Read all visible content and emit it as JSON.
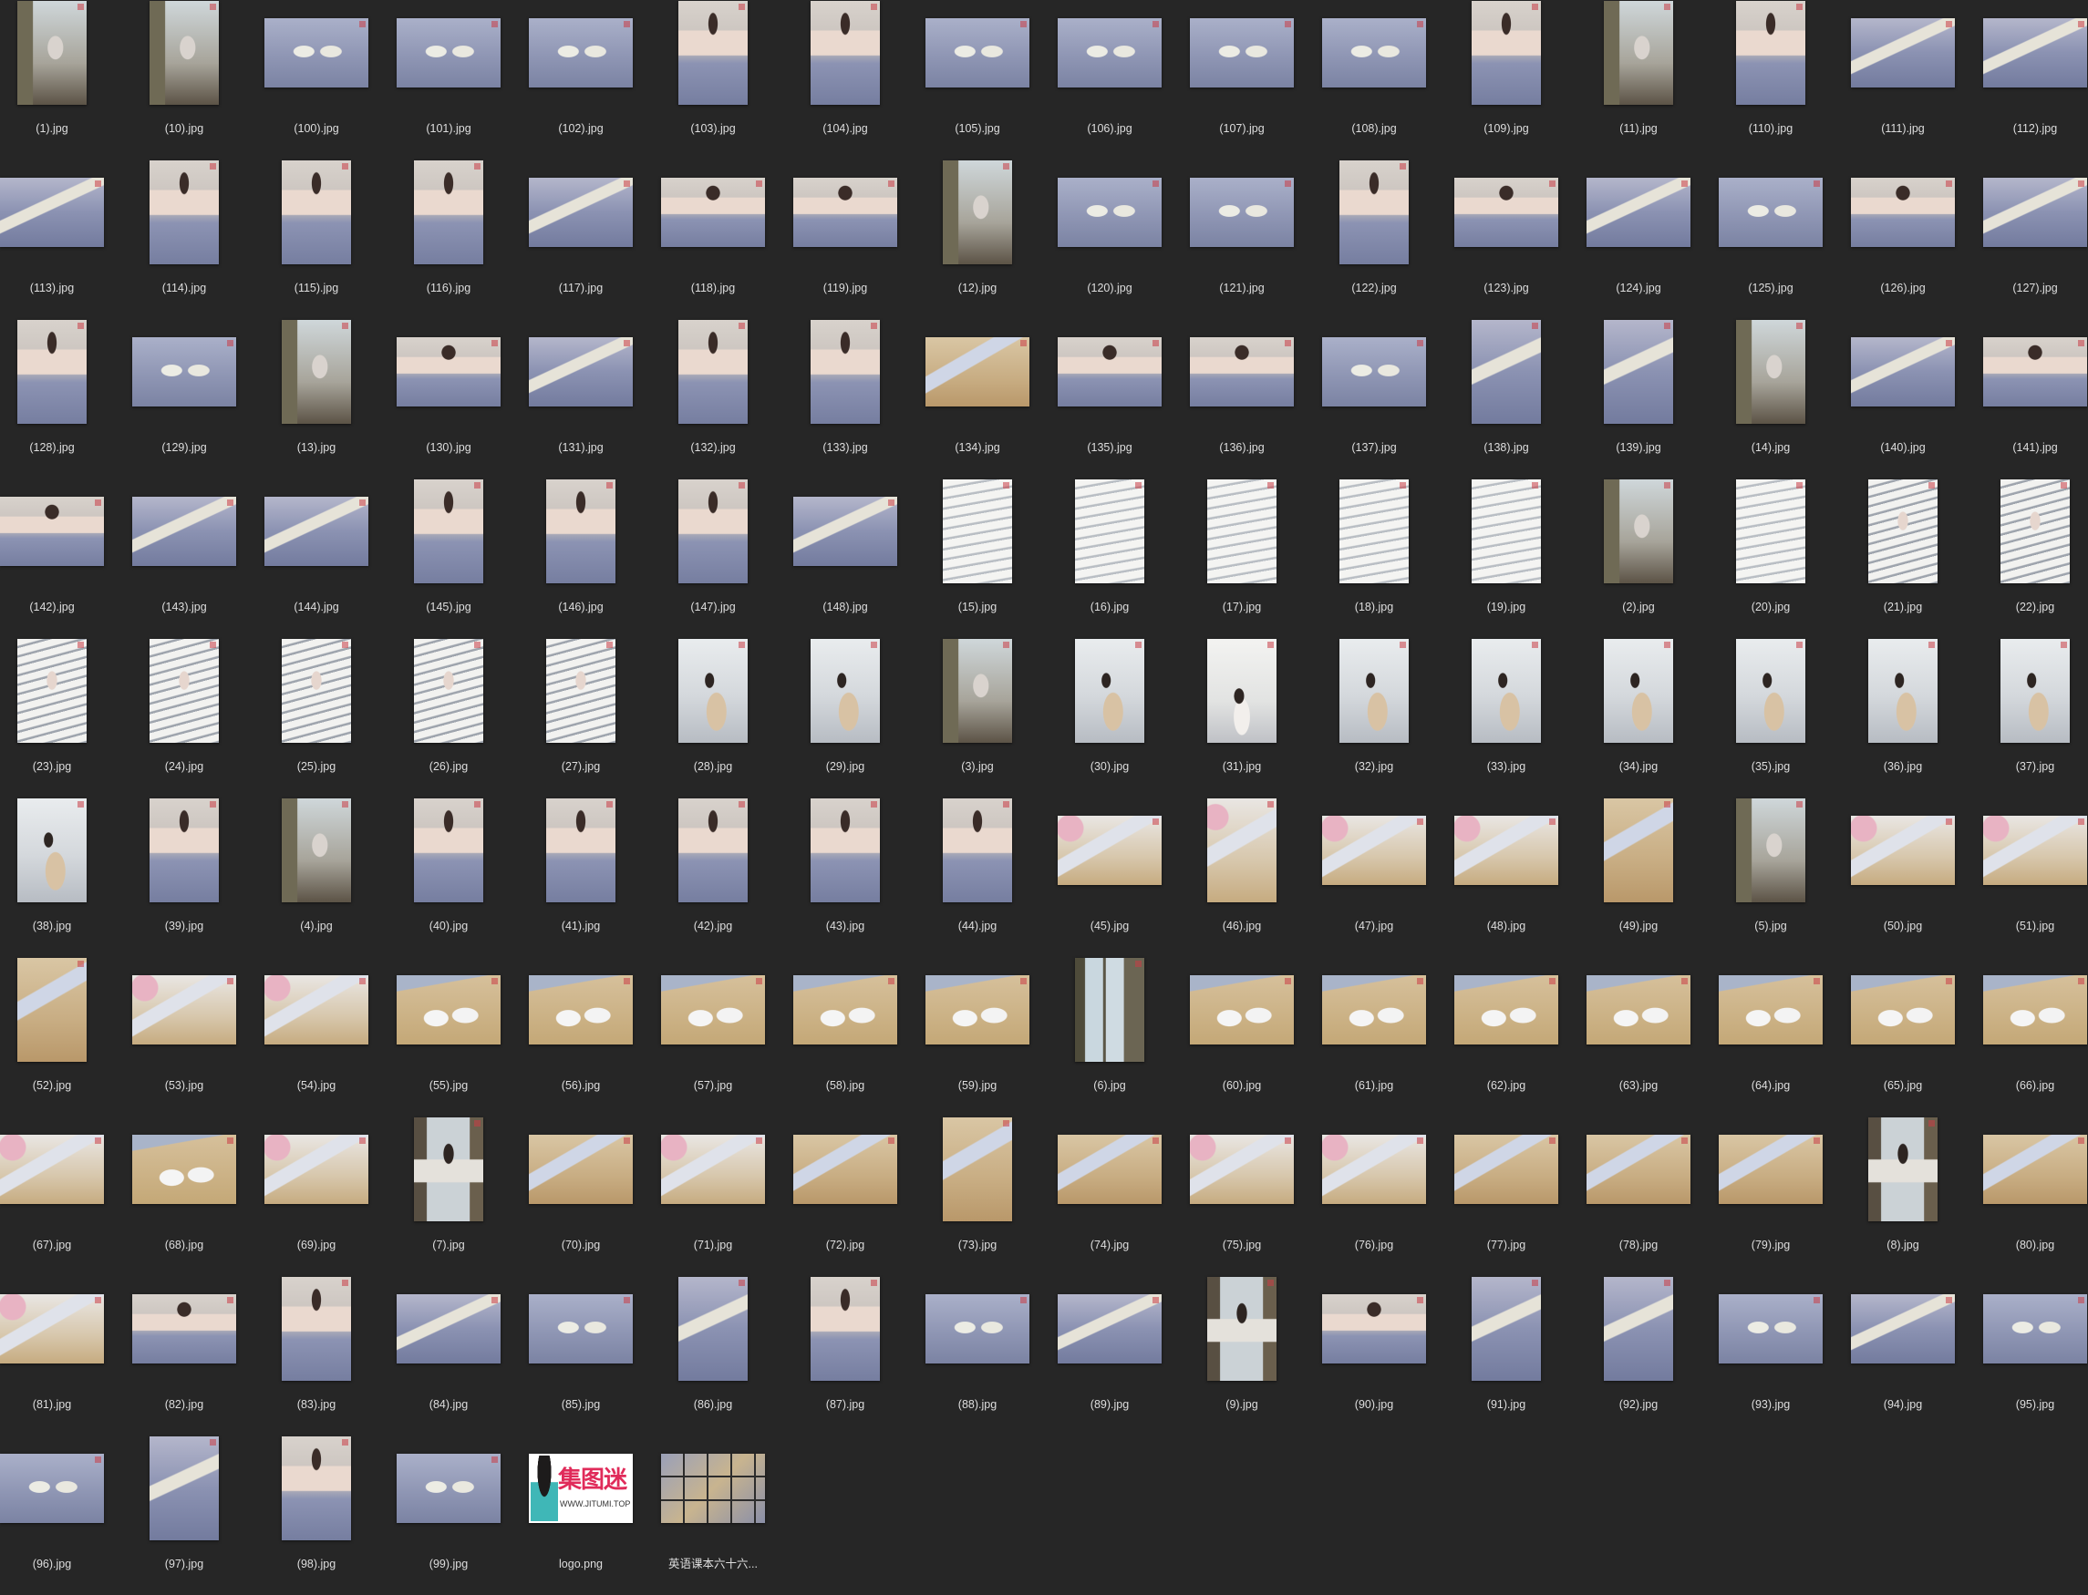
{
  "files": [
    {
      "name": "(1).jpg",
      "orient": "portrait",
      "scene": "room"
    },
    {
      "name": "(10).jpg",
      "orient": "portrait",
      "scene": "room"
    },
    {
      "name": "(100).jpg",
      "orient": "landscape",
      "scene": "bedfeet"
    },
    {
      "name": "(101).jpg",
      "orient": "landscape",
      "scene": "bedfeet"
    },
    {
      "name": "(102).jpg",
      "orient": "landscape",
      "scene": "bedfeet"
    },
    {
      "name": "(103).jpg",
      "orient": "portrait",
      "scene": "bedsit"
    },
    {
      "name": "(104).jpg",
      "orient": "portrait",
      "scene": "bedsit"
    },
    {
      "name": "(105).jpg",
      "orient": "landscape",
      "scene": "bedfeet"
    },
    {
      "name": "(106).jpg",
      "orient": "landscape",
      "scene": "bedfeet"
    },
    {
      "name": "(107).jpg",
      "orient": "landscape",
      "scene": "bedfeet"
    },
    {
      "name": "(108).jpg",
      "orient": "landscape",
      "scene": "bedfeet"
    },
    {
      "name": "(109).jpg",
      "orient": "portrait",
      "scene": "bedsit"
    },
    {
      "name": "(11).jpg",
      "orient": "portrait",
      "scene": "room"
    },
    {
      "name": "(110).jpg",
      "orient": "portrait",
      "scene": "bedsit"
    },
    {
      "name": "(111).jpg",
      "orient": "landscape",
      "scene": "bedleg"
    },
    {
      "name": "(112).jpg",
      "orient": "landscape",
      "scene": "bedleg"
    },
    {
      "name": "(113).jpg",
      "orient": "landscape",
      "scene": "bedleg"
    },
    {
      "name": "(114).jpg",
      "orient": "portrait",
      "scene": "bedsit"
    },
    {
      "name": "(115).jpg",
      "orient": "portrait",
      "scene": "bedsit"
    },
    {
      "name": "(116).jpg",
      "orient": "portrait",
      "scene": "bedsit"
    },
    {
      "name": "(117).jpg",
      "orient": "landscape",
      "scene": "bedleg"
    },
    {
      "name": "(118).jpg",
      "orient": "landscape",
      "scene": "bedsit"
    },
    {
      "name": "(119).jpg",
      "orient": "landscape",
      "scene": "bedsit"
    },
    {
      "name": "(12).jpg",
      "orient": "portrait",
      "scene": "room"
    },
    {
      "name": "(120).jpg",
      "orient": "landscape",
      "scene": "bedfeet"
    },
    {
      "name": "(121).jpg",
      "orient": "landscape",
      "scene": "bedfeet"
    },
    {
      "name": "(122).jpg",
      "orient": "portrait",
      "scene": "bedsit"
    },
    {
      "name": "(123).jpg",
      "orient": "landscape",
      "scene": "bedsit"
    },
    {
      "name": "(124).jpg",
      "orient": "landscape",
      "scene": "bedleg"
    },
    {
      "name": "(125).jpg",
      "orient": "landscape",
      "scene": "bedfeet"
    },
    {
      "name": "(126).jpg",
      "orient": "landscape",
      "scene": "bedsit"
    },
    {
      "name": "(127).jpg",
      "orient": "landscape",
      "scene": "bedleg"
    },
    {
      "name": "(128).jpg",
      "orient": "portrait",
      "scene": "bedsit"
    },
    {
      "name": "(129).jpg",
      "orient": "landscape",
      "scene": "bedfeet"
    },
    {
      "name": "(13).jpg",
      "orient": "portrait",
      "scene": "room"
    },
    {
      "name": "(130).jpg",
      "orient": "landscape",
      "scene": "bedsit"
    },
    {
      "name": "(131).jpg",
      "orient": "landscape",
      "scene": "bedleg"
    },
    {
      "name": "(132).jpg",
      "orient": "portrait",
      "scene": "bedsit"
    },
    {
      "name": "(133).jpg",
      "orient": "portrait",
      "scene": "bedsit"
    },
    {
      "name": "(134).jpg",
      "orient": "landscape",
      "scene": "floor"
    },
    {
      "name": "(135).jpg",
      "orient": "landscape",
      "scene": "bedsit"
    },
    {
      "name": "(136).jpg",
      "orient": "landscape",
      "scene": "bedsit"
    },
    {
      "name": "(137).jpg",
      "orient": "landscape",
      "scene": "bedfeet"
    },
    {
      "name": "(138).jpg",
      "orient": "portrait",
      "scene": "bedleg"
    },
    {
      "name": "(139).jpg",
      "orient": "portrait",
      "scene": "bedleg"
    },
    {
      "name": "(14).jpg",
      "orient": "portrait",
      "scene": "room"
    },
    {
      "name": "(140).jpg",
      "orient": "landscape",
      "scene": "bedleg"
    },
    {
      "name": "(141).jpg",
      "orient": "landscape",
      "scene": "bedsit"
    },
    {
      "name": "(142).jpg",
      "orient": "landscape",
      "scene": "bedsit"
    },
    {
      "name": "(143).jpg",
      "orient": "landscape",
      "scene": "bedleg"
    },
    {
      "name": "(144).jpg",
      "orient": "landscape",
      "scene": "bedleg"
    },
    {
      "name": "(145).jpg",
      "orient": "portrait",
      "scene": "bedsit"
    },
    {
      "name": "(146).jpg",
      "orient": "portrait",
      "scene": "bedsit"
    },
    {
      "name": "(147).jpg",
      "orient": "portrait",
      "scene": "bedsit"
    },
    {
      "name": "(148).jpg",
      "orient": "landscape",
      "scene": "bedleg"
    },
    {
      "name": "(15).jpg",
      "orient": "portrait",
      "scene": "stairs"
    },
    {
      "name": "(16).jpg",
      "orient": "portrait",
      "scene": "stairs"
    },
    {
      "name": "(17).jpg",
      "orient": "portrait",
      "scene": "stairs"
    },
    {
      "name": "(18).jpg",
      "orient": "portrait",
      "scene": "stairs"
    },
    {
      "name": "(19).jpg",
      "orient": "portrait",
      "scene": "stairs"
    },
    {
      "name": "(2).jpg",
      "orient": "portrait",
      "scene": "room"
    },
    {
      "name": "(20).jpg",
      "orient": "portrait",
      "scene": "stairs"
    },
    {
      "name": "(21).jpg",
      "orient": "portrait",
      "scene": "stairs2"
    },
    {
      "name": "(22).jpg",
      "orient": "portrait",
      "scene": "stairs2"
    },
    {
      "name": "(23).jpg",
      "orient": "portrait",
      "scene": "stairs2"
    },
    {
      "name": "(24).jpg",
      "orient": "portrait",
      "scene": "stairs2"
    },
    {
      "name": "(25).jpg",
      "orient": "portrait",
      "scene": "stairs2"
    },
    {
      "name": "(26).jpg",
      "orient": "portrait",
      "scene": "stairs2"
    },
    {
      "name": "(27).jpg",
      "orient": "portrait",
      "scene": "stairs2"
    },
    {
      "name": "(28).jpg",
      "orient": "portrait",
      "scene": "chair"
    },
    {
      "name": "(29).jpg",
      "orient": "portrait",
      "scene": "chair"
    },
    {
      "name": "(3).jpg",
      "orient": "portrait",
      "scene": "room"
    },
    {
      "name": "(30).jpg",
      "orient": "portrait",
      "scene": "chair"
    },
    {
      "name": "(31).jpg",
      "orient": "portrait",
      "scene": "wall"
    },
    {
      "name": "(32).jpg",
      "orient": "portrait",
      "scene": "chair"
    },
    {
      "name": "(33).jpg",
      "orient": "portrait",
      "scene": "chair"
    },
    {
      "name": "(34).jpg",
      "orient": "portrait",
      "scene": "chair"
    },
    {
      "name": "(35).jpg",
      "orient": "portrait",
      "scene": "chair"
    },
    {
      "name": "(36).jpg",
      "orient": "portrait",
      "scene": "chair"
    },
    {
      "name": "(37).jpg",
      "orient": "portrait",
      "scene": "chair"
    },
    {
      "name": "(38).jpg",
      "orient": "portrait",
      "scene": "chair"
    },
    {
      "name": "(39).jpg",
      "orient": "portrait",
      "scene": "bedsit"
    },
    {
      "name": "(4).jpg",
      "orient": "portrait",
      "scene": "room"
    },
    {
      "name": "(40).jpg",
      "orient": "portrait",
      "scene": "bedsit"
    },
    {
      "name": "(41).jpg",
      "orient": "portrait",
      "scene": "bedsit"
    },
    {
      "name": "(42).jpg",
      "orient": "portrait",
      "scene": "bedsit"
    },
    {
      "name": "(43).jpg",
      "orient": "portrait",
      "scene": "bedsit"
    },
    {
      "name": "(44).jpg",
      "orient": "portrait",
      "scene": "bedsit"
    },
    {
      "name": "(45).jpg",
      "orient": "landscape",
      "scene": "floorpink"
    },
    {
      "name": "(46).jpg",
      "orient": "portrait",
      "scene": "floorpink"
    },
    {
      "name": "(47).jpg",
      "orient": "landscape",
      "scene": "floorpink"
    },
    {
      "name": "(48).jpg",
      "orient": "landscape",
      "scene": "floorpink"
    },
    {
      "name": "(49).jpg",
      "orient": "portrait",
      "scene": "floor"
    },
    {
      "name": "(5).jpg",
      "orient": "portrait",
      "scene": "room"
    },
    {
      "name": "(50).jpg",
      "orient": "landscape",
      "scene": "floorpink"
    },
    {
      "name": "(51).jpg",
      "orient": "landscape",
      "scene": "floorpink"
    },
    {
      "name": "(52).jpg",
      "orient": "portrait",
      "scene": "floor"
    },
    {
      "name": "(53).jpg",
      "orient": "landscape",
      "scene": "floorpink"
    },
    {
      "name": "(54).jpg",
      "orient": "landscape",
      "scene": "floorpink"
    },
    {
      "name": "(55).jpg",
      "orient": "landscape",
      "scene": "shoes"
    },
    {
      "name": "(56).jpg",
      "orient": "landscape",
      "scene": "shoes"
    },
    {
      "name": "(57).jpg",
      "orient": "landscape",
      "scene": "shoes"
    },
    {
      "name": "(58).jpg",
      "orient": "landscape",
      "scene": "shoes"
    },
    {
      "name": "(59).jpg",
      "orient": "landscape",
      "scene": "shoes"
    },
    {
      "name": "(6).jpg",
      "orient": "portrait",
      "scene": "window"
    },
    {
      "name": "(60).jpg",
      "orient": "landscape",
      "scene": "shoes"
    },
    {
      "name": "(61).jpg",
      "orient": "landscape",
      "scene": "shoes"
    },
    {
      "name": "(62).jpg",
      "orient": "landscape",
      "scene": "shoes"
    },
    {
      "name": "(63).jpg",
      "orient": "landscape",
      "scene": "shoes"
    },
    {
      "name": "(64).jpg",
      "orient": "landscape",
      "scene": "shoes"
    },
    {
      "name": "(65).jpg",
      "orient": "landscape",
      "scene": "shoes"
    },
    {
      "name": "(66).jpg",
      "orient": "landscape",
      "scene": "shoes"
    },
    {
      "name": "(67).jpg",
      "orient": "landscape",
      "scene": "floorpink"
    },
    {
      "name": "(68).jpg",
      "orient": "landscape",
      "scene": "shoes"
    },
    {
      "name": "(69).jpg",
      "orient": "landscape",
      "scene": "floorpink"
    },
    {
      "name": "(7).jpg",
      "orient": "portrait",
      "scene": "sofa"
    },
    {
      "name": "(70).jpg",
      "orient": "landscape",
      "scene": "floor"
    },
    {
      "name": "(71).jpg",
      "orient": "landscape",
      "scene": "floorpink"
    },
    {
      "name": "(72).jpg",
      "orient": "landscape",
      "scene": "floor"
    },
    {
      "name": "(73).jpg",
      "orient": "portrait",
      "scene": "floor"
    },
    {
      "name": "(74).jpg",
      "orient": "landscape",
      "scene": "floor"
    },
    {
      "name": "(75).jpg",
      "orient": "landscape",
      "scene": "floorpink"
    },
    {
      "name": "(76).jpg",
      "orient": "landscape",
      "scene": "floorpink"
    },
    {
      "name": "(77).jpg",
      "orient": "landscape",
      "scene": "floor"
    },
    {
      "name": "(78).jpg",
      "orient": "landscape",
      "scene": "floor"
    },
    {
      "name": "(79).jpg",
      "orient": "landscape",
      "scene": "floor"
    },
    {
      "name": "(8).jpg",
      "orient": "portrait",
      "scene": "sofa"
    },
    {
      "name": "(80).jpg",
      "orient": "landscape",
      "scene": "floor"
    },
    {
      "name": "(81).jpg",
      "orient": "landscape",
      "scene": "floorpink"
    },
    {
      "name": "(82).jpg",
      "orient": "landscape",
      "scene": "bedsit"
    },
    {
      "name": "(83).jpg",
      "orient": "portrait",
      "scene": "bedsit"
    },
    {
      "name": "(84).jpg",
      "orient": "landscape",
      "scene": "bedleg"
    },
    {
      "name": "(85).jpg",
      "orient": "landscape",
      "scene": "bedfeet"
    },
    {
      "name": "(86).jpg",
      "orient": "portrait",
      "scene": "bedleg"
    },
    {
      "name": "(87).jpg",
      "orient": "portrait",
      "scene": "bedsit"
    },
    {
      "name": "(88).jpg",
      "orient": "landscape",
      "scene": "bedfeet"
    },
    {
      "name": "(89).jpg",
      "orient": "landscape",
      "scene": "bedleg"
    },
    {
      "name": "(9).jpg",
      "orient": "portrait",
      "scene": "sofa"
    },
    {
      "name": "(90).jpg",
      "orient": "landscape",
      "scene": "bedsit"
    },
    {
      "name": "(91).jpg",
      "orient": "portrait",
      "scene": "bedleg"
    },
    {
      "name": "(92).jpg",
      "orient": "portrait",
      "scene": "bedleg"
    },
    {
      "name": "(93).jpg",
      "orient": "landscape",
      "scene": "bedfeet"
    },
    {
      "name": "(94).jpg",
      "orient": "landscape",
      "scene": "bedleg"
    },
    {
      "name": "(95).jpg",
      "orient": "landscape",
      "scene": "bedfeet"
    },
    {
      "name": "(96).jpg",
      "orient": "landscape",
      "scene": "bedfeet"
    },
    {
      "name": "(97).jpg",
      "orient": "portrait",
      "scene": "bedleg"
    },
    {
      "name": "(98).jpg",
      "orient": "portrait",
      "scene": "bedsit"
    },
    {
      "name": "(99).jpg",
      "orient": "landscape",
      "scene": "bedfeet"
    },
    {
      "name": "logo.png",
      "orient": "landscape",
      "scene": "logo"
    },
    {
      "name": "英语课本六十六...",
      "orient": "landscape",
      "scene": "collage"
    }
  ],
  "logo": {
    "brand_text": "集图迷",
    "url_text": "WWW.JITUMI.TOP"
  },
  "colors": {
    "background": "#262626",
    "label_text": "#dedede"
  }
}
